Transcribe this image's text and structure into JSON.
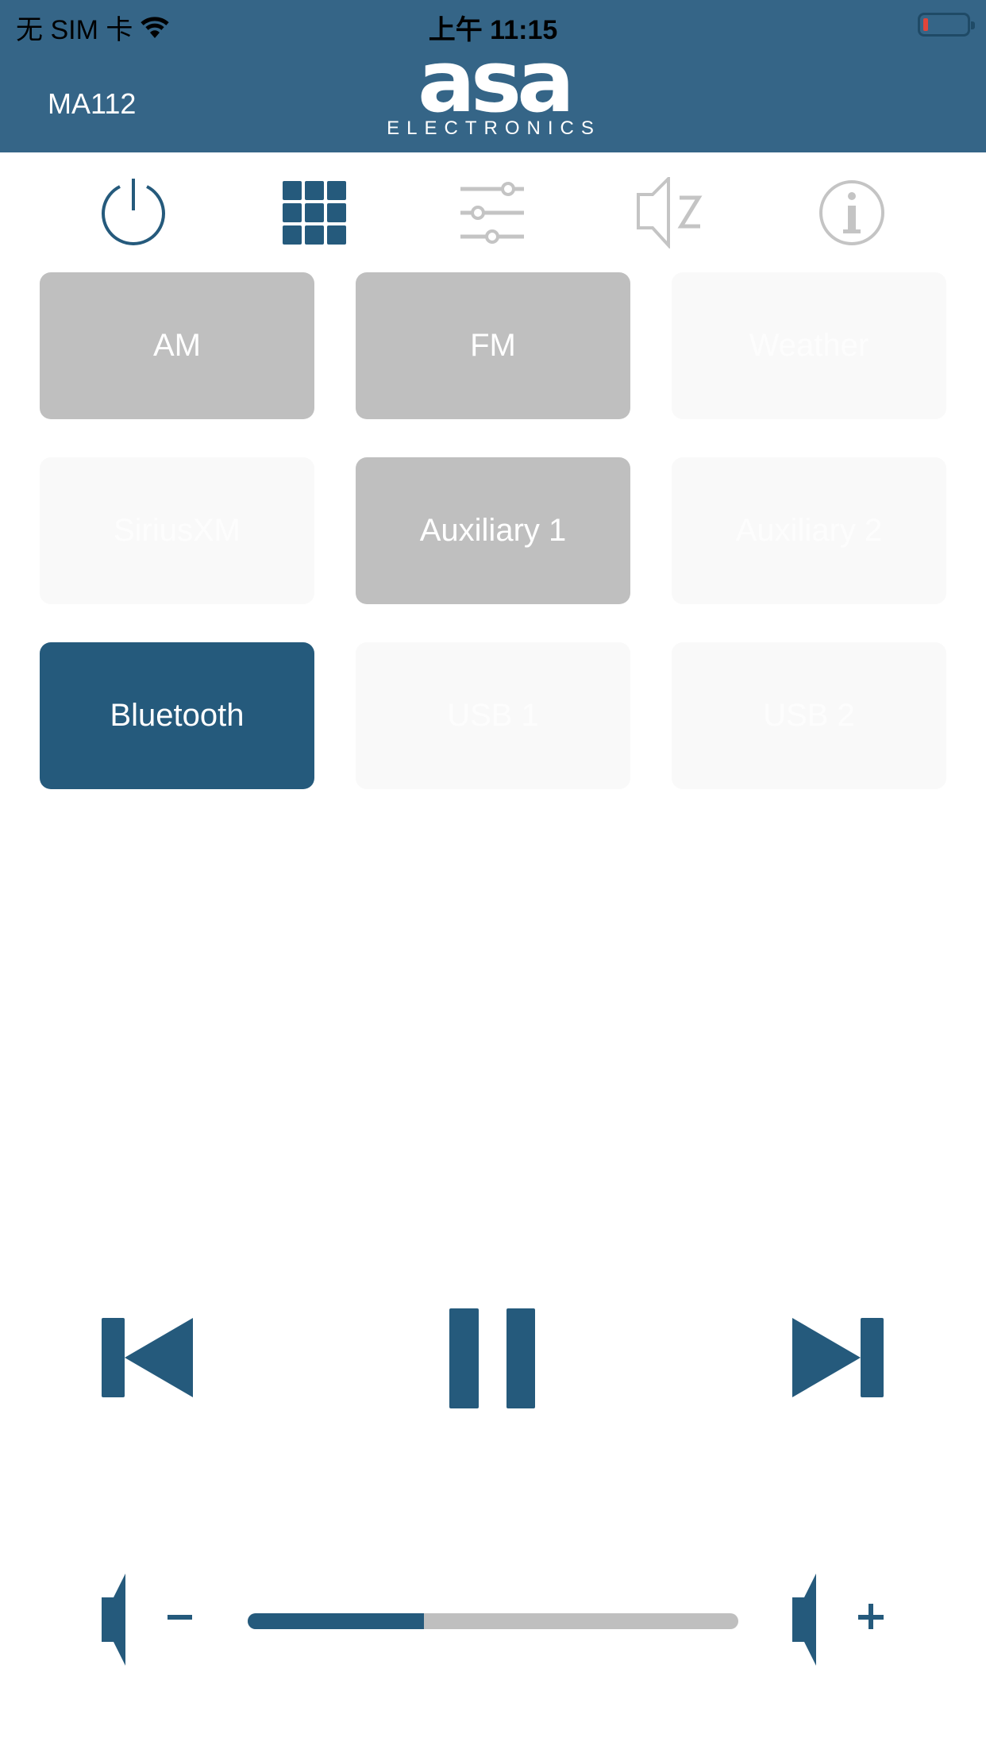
{
  "status_bar": {
    "carrier": "无 SIM 卡",
    "time": "上午 11:15",
    "battery_level": "low"
  },
  "header": {
    "model": "MA112",
    "logo_main": "asa",
    "logo_sub": "ELECTRONICS"
  },
  "tabs": [
    {
      "name": "power",
      "icon": "power-icon",
      "active": false
    },
    {
      "name": "sources",
      "icon": "grid-icon",
      "active": true
    },
    {
      "name": "equalizer",
      "icon": "sliders-icon",
      "active": false
    },
    {
      "name": "sleep",
      "icon": "speaker-sleep-icon",
      "active": false
    },
    {
      "name": "info",
      "icon": "info-icon",
      "active": false
    }
  ],
  "sources": [
    {
      "label": "AM",
      "state": "enabled"
    },
    {
      "label": "FM",
      "state": "enabled"
    },
    {
      "label": "Weather",
      "state": "disabled"
    },
    {
      "label": "SiriusXM",
      "state": "disabled"
    },
    {
      "label": "Auxiliary 1",
      "state": "enabled"
    },
    {
      "label": "Auxiliary 2",
      "state": "disabled"
    },
    {
      "label": "Bluetooth",
      "state": "active"
    },
    {
      "label": "USB 1",
      "state": "disabled"
    },
    {
      "label": "USB 2",
      "state": "disabled"
    }
  ],
  "playback": {
    "previous": "previous-track",
    "play_state": "pause",
    "next": "next-track"
  },
  "volume": {
    "level_percent": 36,
    "down_symbol": "−",
    "up_symbol": "+"
  },
  "colors": {
    "header": "#356587",
    "accent": "#255a7c",
    "enabled_button": "#bfbfbf",
    "disabled_button": "#f9f9f9",
    "inactive_icon": "#c4c4c4"
  }
}
